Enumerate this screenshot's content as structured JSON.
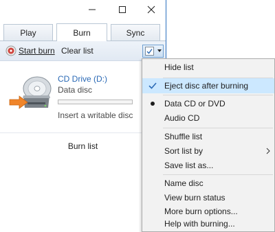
{
  "window": {
    "minimize_icon": "minimize-icon",
    "maximize_icon": "maximize-icon",
    "close_icon": "close-icon"
  },
  "tabs": [
    {
      "label": "Play"
    },
    {
      "label": "Burn"
    },
    {
      "label": "Sync"
    }
  ],
  "toolbar": {
    "start_burn_label": "Start burn",
    "clear_list_label": "Clear list",
    "start_burn_icon": "burn-disc-icon",
    "options_icon": "list-options-icon"
  },
  "drive": {
    "title": "CD Drive (D:)",
    "type": "Data disc",
    "status": "Insert a writable disc",
    "progress": 0,
    "icon": "cd-drive-icon"
  },
  "burn_list_label": "Burn list",
  "menu": {
    "items": [
      {
        "label": "Hide list"
      },
      {
        "label": "Eject disc after burning",
        "checked": true
      },
      {
        "label": "Data CD or DVD",
        "selected": true
      },
      {
        "label": "Audio CD"
      },
      {
        "label": "Shuffle list"
      },
      {
        "label": "Sort list by",
        "submenu": true
      },
      {
        "label": "Save list as..."
      },
      {
        "label": "Name disc"
      },
      {
        "label": "View burn status"
      },
      {
        "label": "More burn options..."
      },
      {
        "label": "Help with burning..."
      }
    ]
  },
  "colors": {
    "accent": "#2a69b5",
    "menu_highlight": "#cce8ff",
    "menu_bg": "#f2f2f2"
  }
}
